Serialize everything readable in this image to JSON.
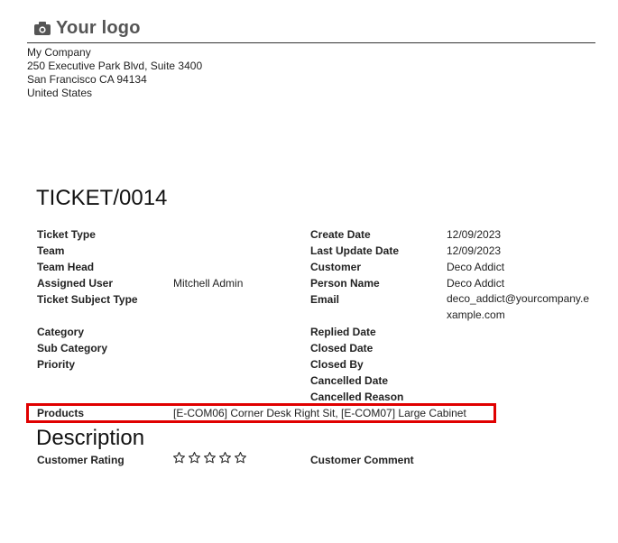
{
  "header": {
    "logo_text": "Your logo",
    "logo_icon": "camera-icon"
  },
  "company": {
    "name": "My Company",
    "street": "250 Executive Park Blvd, Suite 3400",
    "city_line": "San Francisco CA 94134",
    "country": "United States"
  },
  "ticket": {
    "title": "TICKET/0014"
  },
  "fields_left": [
    {
      "label": "Ticket Type",
      "value": ""
    },
    {
      "label": "Team",
      "value": ""
    },
    {
      "label": "Team Head",
      "value": ""
    },
    {
      "label": "Assigned User",
      "value": "Mitchell Admin"
    },
    {
      "label": "Ticket Subject Type",
      "value": ""
    },
    {
      "label": "Category",
      "value": ""
    },
    {
      "label": "Sub Category",
      "value": ""
    },
    {
      "label": "Priority",
      "value": ""
    }
  ],
  "fields_right": [
    {
      "label": "Create Date",
      "value": "12/09/2023"
    },
    {
      "label": "Last Update Date",
      "value": "12/09/2023"
    },
    {
      "label": "Customer",
      "value": "Deco Addict"
    },
    {
      "label": "Person Name",
      "value": "Deco Addict"
    },
    {
      "label": "Email",
      "value": "deco_addict@yourcompany.example.com"
    },
    {
      "label": "Replied Date",
      "value": ""
    },
    {
      "label": "Closed Date",
      "value": ""
    },
    {
      "label": "Closed By",
      "value": ""
    },
    {
      "label": "Cancelled Date",
      "value": ""
    },
    {
      "label": "Cancelled Reason",
      "value": ""
    }
  ],
  "products": {
    "label": "Products",
    "value": "[E-COM06] Corner Desk Right Sit, [E-COM07] Large Cabinet"
  },
  "description": {
    "title": "Description"
  },
  "rating": {
    "label": "Customer Rating",
    "stars_filled": 0,
    "stars_total": 5,
    "comment_label": "Customer Comment",
    "highlight_color": "#e00000"
  }
}
